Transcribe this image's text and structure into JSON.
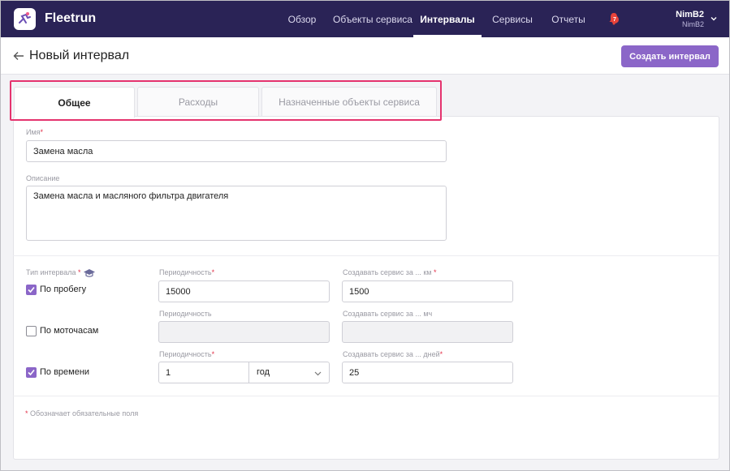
{
  "app": {
    "brand": "Fleetrun"
  },
  "nav": {
    "items": [
      {
        "label": "Обзор"
      },
      {
        "label": "Объекты сервиса"
      },
      {
        "label": "Интервалы"
      },
      {
        "label": "Сервисы"
      },
      {
        "label": "Отчеты"
      }
    ],
    "active": "Интервалы",
    "notifications_count": "7"
  },
  "user": {
    "name": "NimB2",
    "account": "NimB2"
  },
  "header": {
    "title": "Новый интервал",
    "create_label": "Создать интервал"
  },
  "tabs": [
    {
      "label": "Общее"
    },
    {
      "label": "Расходы"
    },
    {
      "label": "Назначенные объекты сервиса"
    }
  ],
  "form": {
    "name_label": "Имя",
    "name_value": "Замена масла",
    "description_label": "Описание",
    "description_value": "Замена масла и масляного фильтра двигателя",
    "interval_type_label": "Тип интервала",
    "required_mark": "*",
    "rows": [
      {
        "type_label": "По пробегу",
        "checked": true,
        "period_label": "Периодичность",
        "period_value": "15000",
        "create_label": "Создавать сервис за ... км",
        "create_value": "1500"
      },
      {
        "type_label": "По моточасам",
        "checked": false,
        "period_label": "Периодичность",
        "period_value": "",
        "create_label": "Создавать сервис за ... мч",
        "create_value": ""
      },
      {
        "type_label": "По времени",
        "checked": true,
        "period_label": "Периодичность",
        "period_value": "1",
        "period_unit": "год",
        "create_label": "Создавать сервис за ... дней",
        "create_value": "25"
      }
    ],
    "footnote": "Обозначает обязательные поля"
  },
  "colors": {
    "topbar": "#2a2356",
    "accent": "#8b66c8",
    "required": "#e2334a",
    "highlight": "#e5336e"
  }
}
